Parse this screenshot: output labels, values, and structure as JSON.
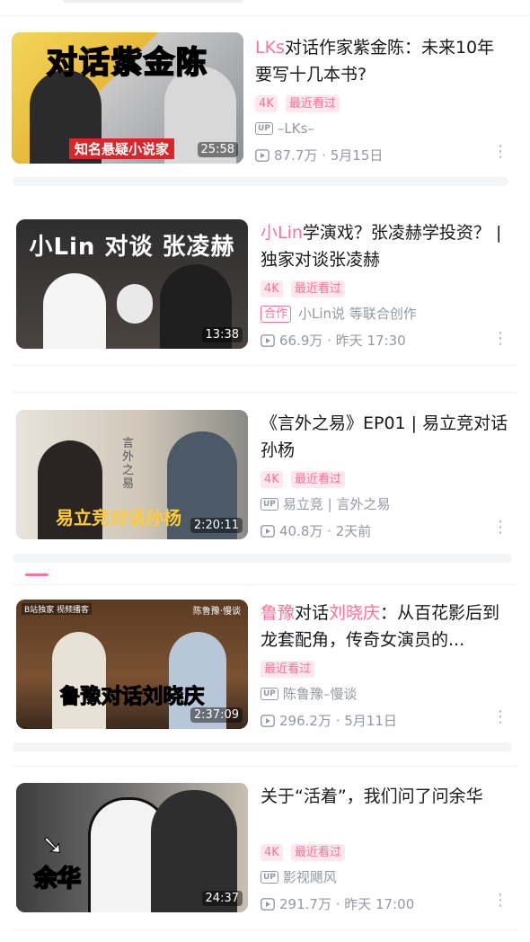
{
  "videos": [
    {
      "thumb_text": "对话紫金陈",
      "thumb_subtext": "知名悬疑小说家",
      "duration": "25:58",
      "title_hl": "LKs",
      "title_rest": "对话作家紫金陈：未来10年要写十几本书?",
      "badges": [
        "4K",
        "最近看过"
      ],
      "uploader_icon": "UP",
      "uploader": "–LKs–",
      "stats": "87.7万 · 5月15日"
    },
    {
      "thumb_text": "小Lin 对谈 张凌赫",
      "duration": "13:38",
      "title_hl": "小Lin",
      "title_rest": "学演戏？张凌赫学投资？ | 独家对谈张凌赫",
      "badges": [
        "4K",
        "最近看过"
      ],
      "coop_badge": "合作",
      "uploader": "小Lin说 等联合创作",
      "stats": "66.9万 · 昨天 17:30"
    },
    {
      "thumb_text": "易立竞对话孙杨",
      "thumb_side": "言外之易",
      "duration": "2:20:11",
      "title": "《言外之易》EP01 | 易立竞对话孙杨",
      "badges": [
        "4K",
        "最近看过"
      ],
      "uploader_icon": "UP",
      "uploader": "易立竞 | 言外之易",
      "stats": "40.8万 · 2天前"
    },
    {
      "thumb_text": "鲁豫对话刘晓庆",
      "thumb_tag": "B站独家 视频播客",
      "thumb_logo": "陈鲁豫·慢谈",
      "duration": "2:37:09",
      "title_hl1": "鲁豫",
      "title_mid": "对话",
      "title_hl2": "刘晓庆",
      "title_rest": "：从百花影后到龙套配角，传奇女演员的...",
      "badges": [
        "最近看过"
      ],
      "uploader_icon": "UP",
      "uploader": "陈鲁豫–慢谈",
      "stats": "296.2万 · 5月11日"
    },
    {
      "thumb_text": "余华",
      "duration": "24:37",
      "title": "关于“活着”，我们问了问余华",
      "badges": [
        "4K",
        "最近看过"
      ],
      "uploader_icon": "UP",
      "uploader": "影视飓风",
      "stats": "291.7万 · 昨天 17:00"
    }
  ],
  "colors": {
    "accent": "#fb7299",
    "muted": "#9499a0"
  }
}
